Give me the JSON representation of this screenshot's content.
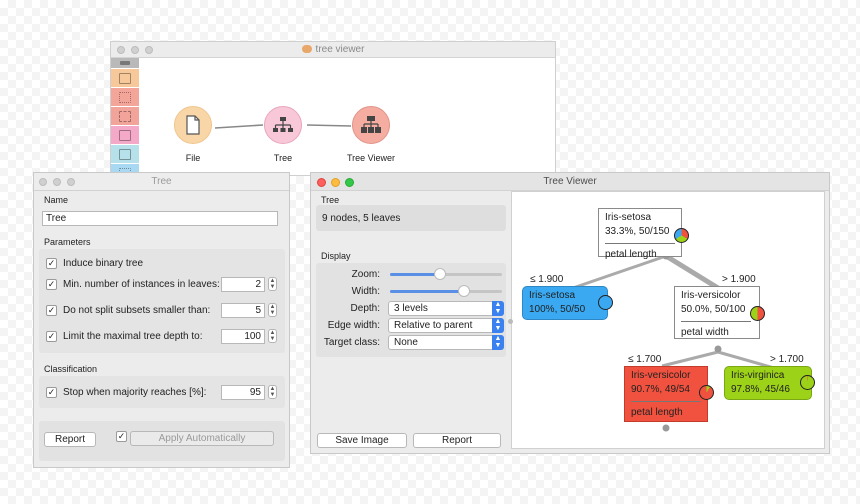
{
  "canvas_window": {
    "title": "tree viewer",
    "nodes": [
      {
        "label": "File",
        "icon": "file-icon"
      },
      {
        "label": "Tree",
        "icon": "tree-icon"
      },
      {
        "label": "Tree Viewer",
        "icon": "tree-viewer-icon"
      }
    ]
  },
  "tree_widget": {
    "title": "Tree",
    "name_section": "Name",
    "name_value": "Tree",
    "parameters_section": "Parameters",
    "params": {
      "binary": "Induce binary tree",
      "min_instances": "Min. number of instances in leaves:",
      "min_instances_value": "2",
      "min_split": "Do not split subsets smaller than:",
      "min_split_value": "5",
      "max_depth": "Limit the maximal tree depth to:",
      "max_depth_value": "100"
    },
    "classification_section": "Classification",
    "stop_majority": "Stop when majority reaches [%]:",
    "stop_majority_value": "95",
    "report_button": "Report",
    "apply_button": "Apply Automatically"
  },
  "tree_viewer": {
    "title": "Tree Viewer",
    "tree_section": "Tree",
    "tree_info": "9 nodes, 5 leaves",
    "display_section": "Display",
    "zoom_label": "Zoom:",
    "zoom_level": 0.45,
    "width_label": "Width:",
    "width_level": 0.66,
    "depth_label": "Depth:",
    "depth_value": "3 levels",
    "edge_width_label": "Edge width:",
    "edge_width_value": "Relative to parent",
    "target_class_label": "Target class:",
    "target_class_value": "None",
    "save_image_button": "Save Image",
    "report_button": "Report",
    "tree": {
      "root": {
        "cls": "Iris-setosa",
        "stats": "33.3%, 50/150",
        "split": "petal length"
      },
      "left_edge": "≤ 1.900",
      "right_edge": "> 1.900",
      "setosa": {
        "cls": "Iris-setosa",
        "stats": "100%, 50/50"
      },
      "versicolor": {
        "cls": "Iris-versicolor",
        "stats": "50.0%, 50/100",
        "split": "petal width"
      },
      "left_edge2": "≤ 1.700",
      "right_edge2": "> 1.700",
      "versicolor2": {
        "cls": "Iris-versicolor",
        "stats": "90.7%, 49/54",
        "split": "petal length"
      },
      "virginica": {
        "cls": "Iris-virginica",
        "stats": "97.8%, 45/46"
      }
    }
  },
  "colors": {
    "setosa": "#3aa9f2",
    "versicolor": "#f0523f",
    "virginica": "#9cd218",
    "accent": "#3b82f0"
  }
}
